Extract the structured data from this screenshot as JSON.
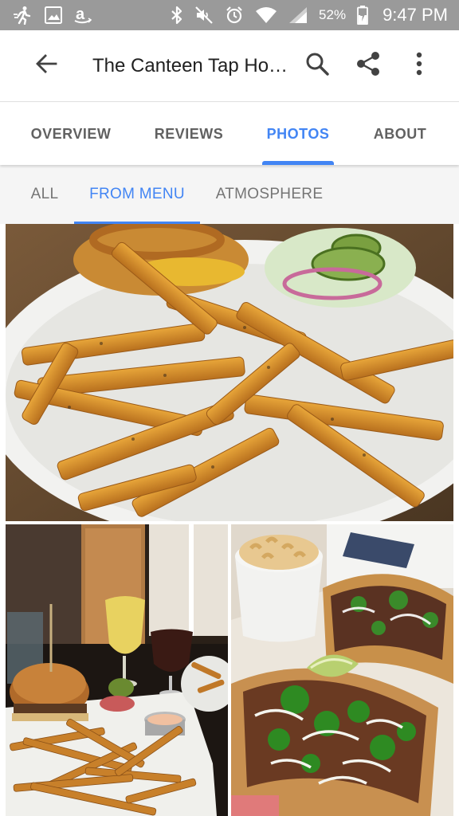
{
  "status_bar": {
    "battery_percent": "52%",
    "time": "9:47 PM",
    "icons": [
      "activity-icon",
      "image-icon",
      "amazon-icon",
      "bluetooth-icon",
      "vibrate-off-icon",
      "alarm-icon",
      "wifi-icon",
      "signal-icon",
      "battery-charging-icon"
    ]
  },
  "app_bar": {
    "title": "The Canteen Tap Ho…",
    "icons": [
      "back-arrow-icon",
      "search-icon",
      "share-icon",
      "more-vert-icon"
    ]
  },
  "primary_tabs": [
    {
      "label": "OVERVIEW",
      "active": false
    },
    {
      "label": "REVIEWS",
      "active": false
    },
    {
      "label": "PHOTOS",
      "active": true
    },
    {
      "label": "ABOUT",
      "active": false
    }
  ],
  "secondary_tabs": [
    {
      "label": "ALL",
      "active": false
    },
    {
      "label": "FROM MENU",
      "active": true
    },
    {
      "label": "ATMOSPHERE",
      "active": false
    }
  ],
  "colors": {
    "accent": "#4285f4",
    "status_bar": "#9a9a9a",
    "tab_text": "#616161"
  },
  "photos": [
    {
      "subject": "fries-and-burger-plate"
    },
    {
      "subject": "burger-fries-and-beers"
    },
    {
      "subject": "tacos-and-mac-and-cheese"
    }
  ]
}
